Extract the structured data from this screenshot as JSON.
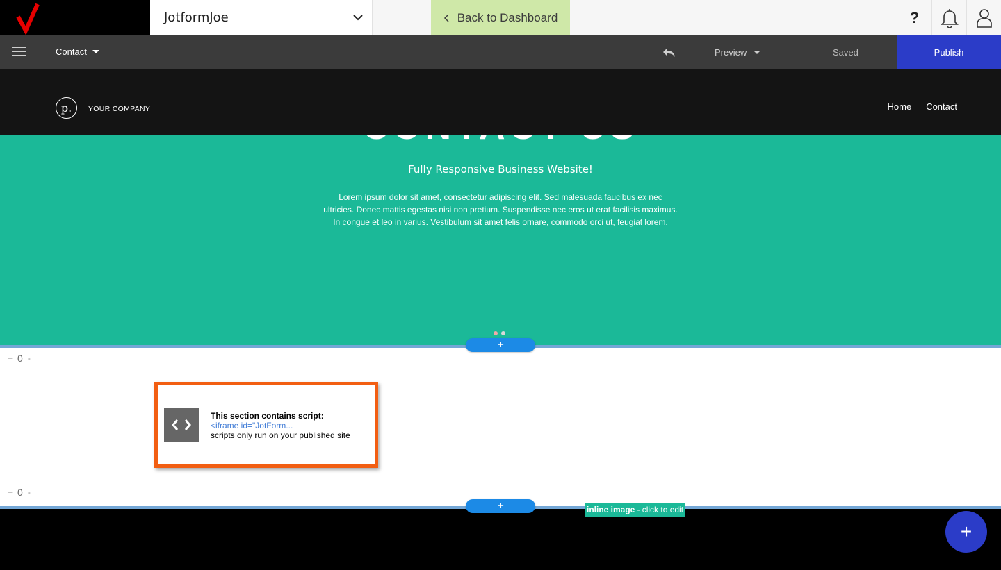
{
  "topbar": {
    "site_name": "JotformJoe",
    "back_label": "Back to Dashboard",
    "icons": [
      "help-icon",
      "bell-icon",
      "user-icon"
    ]
  },
  "toolbar": {
    "page_label": "Contact",
    "preview_label": "Preview",
    "saved_label": "Saved",
    "publish_label": "Publish"
  },
  "site": {
    "logo_letter": "p.",
    "company": "YOUR COMPANY",
    "nav": [
      "Home",
      "Contact"
    ]
  },
  "hero": {
    "title": "CONTACT US",
    "subtitle": "Fully Responsive Business Website!",
    "body": "Lorem ipsum dolor sit amet, consectetur adipiscing elit. Sed malesuada faucibus ex nec ultricies. Donec mattis egestas nisi non pretium. Suspendisse nec eros ut erat facilisis maximus. In congue et leo in varius. Vestibulum sit amet felis ornare, commodo orci ut, feugiat lorem."
  },
  "section": {
    "spacing_top": {
      "plus": "+",
      "value": "0",
      "minus": "-"
    },
    "spacing_bottom": {
      "plus": "+",
      "value": "0",
      "minus": "-"
    },
    "add_symbol": "+",
    "script_heading": "This section contains script:",
    "script_code": "<iframe id=\"JotForm...",
    "script_note": "scripts only run on your published site"
  },
  "inline_image": {
    "bold": "inline image -",
    "rest": "click to edit"
  },
  "fab_symbol": "+",
  "colors": {
    "accent_blue": "#2b3cc8",
    "hero_green": "#1bb998",
    "back_green": "#cfe8a8",
    "highlight_orange": "#f25e12",
    "brand_red": "#e60000"
  }
}
